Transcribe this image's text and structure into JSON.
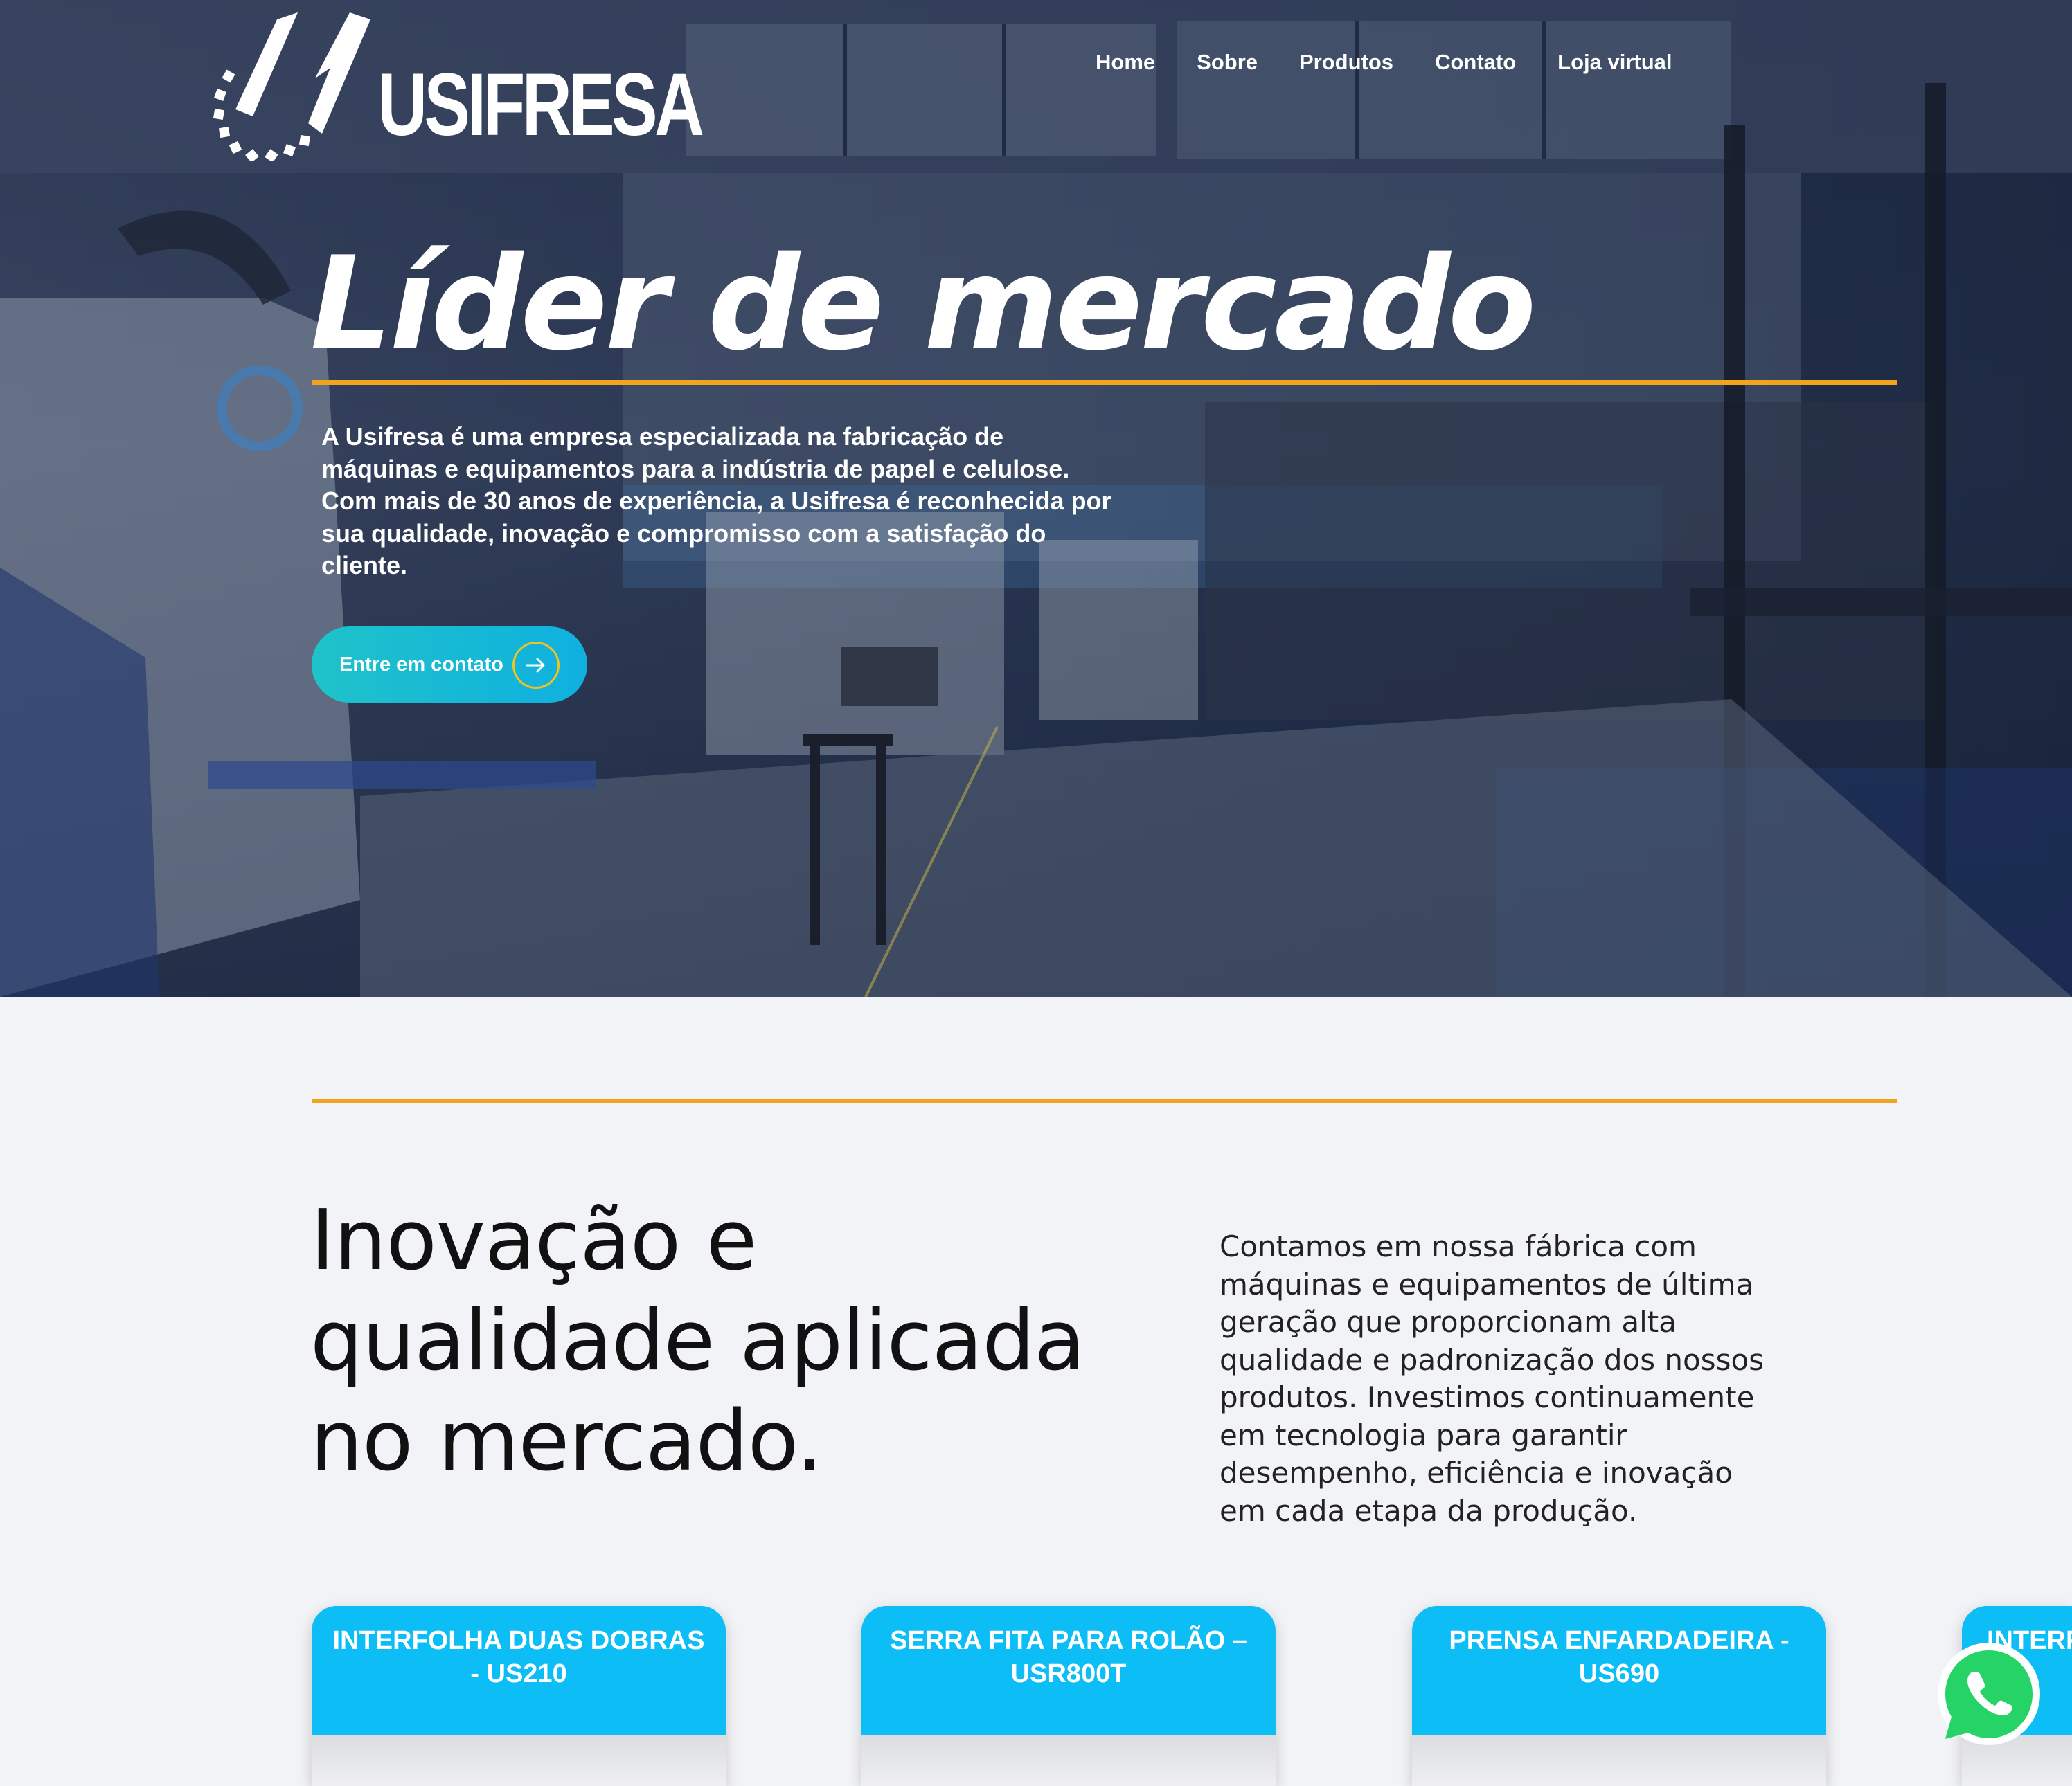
{
  "brand": {
    "name": "USIFRESA"
  },
  "nav": {
    "items": [
      {
        "label": "Home"
      },
      {
        "label": "Sobre"
      },
      {
        "label": "Produtos"
      },
      {
        "label": "Contato"
      },
      {
        "label": "Loja virtual"
      }
    ]
  },
  "hero": {
    "title": "Líder de mercado",
    "description": "A Usifresa é uma empresa especializada na fabricação de máquinas e equipamentos para a indústria de papel e celulose. Com mais de 30 anos de experiência, a Usifresa é reconhecida por sua qualidade, inovação e compromisso com a satisfação do cliente.",
    "cta_label": "Entre em contato",
    "cta_icon": "arrow-right-icon"
  },
  "section": {
    "heading": "Inovação e qualidade aplicada no mercado.",
    "text": "Contamos em nossa fábrica com máquinas e equipamentos de última geração que proporcionam alta qualidade e padronização dos nossos produtos. Investimos continuamente em tecnologia para garantir desempenho, eficiência e inovação em cada etapa da produção."
  },
  "products": [
    {
      "title": "INTERFOLHA DUAS DOBRAS - US210"
    },
    {
      "title": "SERRA FITA PARA ROLÃO – USR800T"
    },
    {
      "title": "PRENSA ENFARDADEIRA - US690"
    },
    {
      "title": "INTERF V"
    }
  ],
  "colors": {
    "accent": "#f2a41e",
    "cta_gradient_start": "#1fc3c9",
    "cta_gradient_end": "#0fb0e0",
    "card_header": "#0cbdf6",
    "whatsapp": "#25d366"
  },
  "floating": {
    "icon": "whatsapp-icon"
  }
}
